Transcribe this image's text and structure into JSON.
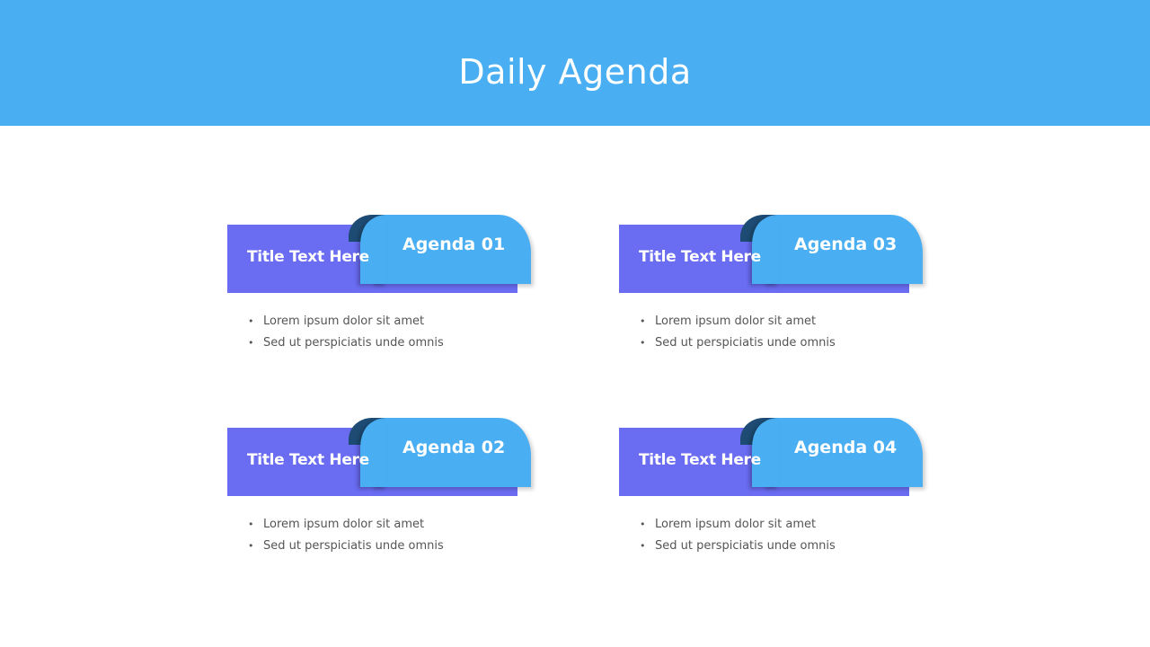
{
  "header": {
    "title": "Daily Agenda",
    "background_color": "#4aaef2"
  },
  "colors": {
    "title_band": "#6a6cf2",
    "tab": "#4aaef2",
    "curl": "#1d4b73",
    "bullet_text": "#555555"
  },
  "cards": [
    {
      "agenda_label": "Agenda 01",
      "title": "Title Text Here",
      "bullets": [
        "Lorem ipsum dolor sit amet",
        "Sed ut perspiciatis  unde omnis"
      ]
    },
    {
      "agenda_label": "Agenda 02",
      "title": "Title Text Here",
      "bullets": [
        "Lorem ipsum dolor sit amet",
        "Sed ut perspiciatis  unde omnis"
      ]
    },
    {
      "agenda_label": "Agenda 03",
      "title": "Title Text Here",
      "bullets": [
        "Lorem ipsum dolor sit amet",
        "Sed ut perspiciatis  unde omnis"
      ]
    },
    {
      "agenda_label": "Agenda 04",
      "title": "Title Text Here",
      "bullets": [
        "Lorem ipsum dolor sit amet",
        "Sed ut perspiciatis  unde omnis"
      ]
    }
  ],
  "bullet_glyph": "•"
}
